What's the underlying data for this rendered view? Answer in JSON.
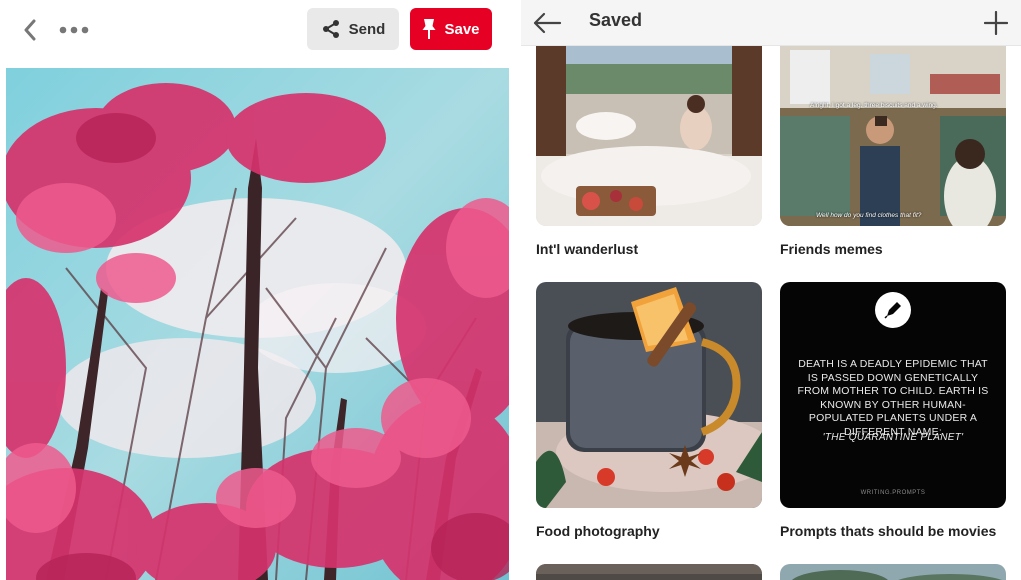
{
  "left_pane": {
    "send_label": "Send",
    "save_label": "Save",
    "icons": {
      "back": "chevron-left-icon",
      "more": "more-dots-icon",
      "share": "share-icon",
      "pin": "pin-icon"
    },
    "colors": {
      "save_accent": "#e60023",
      "send_bg": "#e9e9e9"
    }
  },
  "right_pane": {
    "title": "Saved",
    "icons": {
      "back": "arrow-left-icon",
      "add": "plus-icon"
    },
    "boards": [
      {
        "label": "Int'l wanderlust"
      },
      {
        "label": "Friends memes",
        "captions": [
          "Alright, I got a leg, three biscuits and a wing.",
          "Well how do you find clothes that fit?"
        ]
      },
      {
        "label": "Food photography"
      },
      {
        "label": "Prompts thats should be movies",
        "quote": "DEATH IS A DEADLY EPIDEMIC THAT IS PASSED DOWN GENETICALLY FROM MOTHER TO CHILD. EARTH IS KNOWN BY OTHER HUMAN-POPULATED PLANETS UNDER A DIFFERENT NAME:",
        "quote_sub": "'THE QUARANTINE PLANET'",
        "credit": "WRITING.PROMPTS"
      }
    ]
  }
}
